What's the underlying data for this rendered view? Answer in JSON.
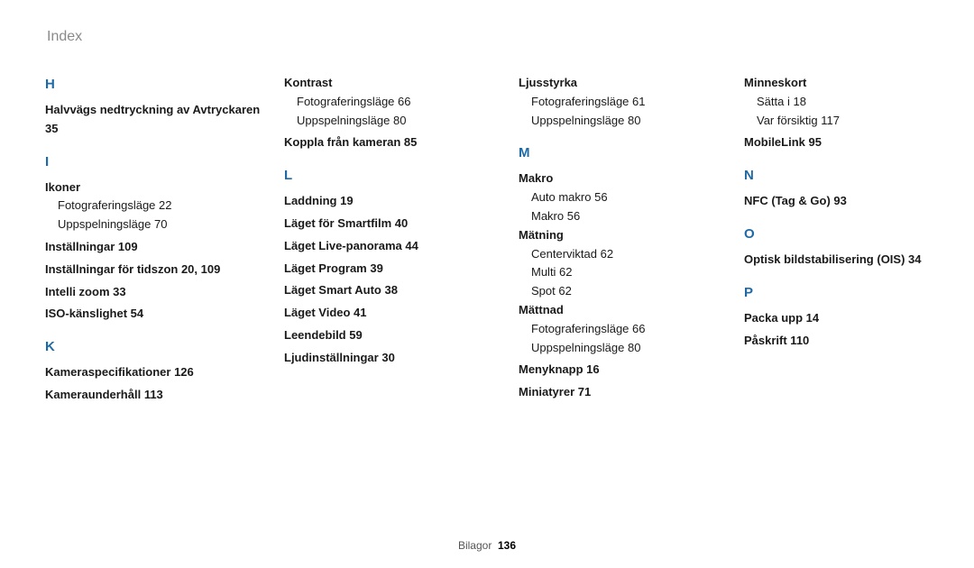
{
  "header": {
    "title": "Index"
  },
  "footer": {
    "section": "Bilagor",
    "page": "136"
  },
  "col1": {
    "H": {
      "entries": [
        {
          "type": "entry",
          "text": "Halvvägs nedtryckning av Avtryckaren  35"
        }
      ]
    },
    "I": {
      "entries": [
        {
          "type": "group",
          "head": "Ikoner",
          "subs": [
            "Fotograferingsläge  22",
            "Uppspelningsläge  70"
          ]
        },
        {
          "type": "entry",
          "text": "Inställningar  109"
        },
        {
          "type": "entry",
          "text": "Inställningar för tidszon  20, 109"
        },
        {
          "type": "entry",
          "text": "Intelli zoom  33"
        },
        {
          "type": "entry",
          "text": "ISO-känslighet  54"
        }
      ]
    },
    "K": {
      "entries": [
        {
          "type": "entry",
          "text": "Kameraspecifikationer  126"
        },
        {
          "type": "entry",
          "text": "Kameraunderhåll  113"
        }
      ]
    }
  },
  "col2": {
    "noletter": {
      "entries": [
        {
          "type": "group",
          "head": "Kontrast",
          "subs": [
            "Fotograferingsläge  66",
            "Uppspelningsläge  80"
          ]
        },
        {
          "type": "entry",
          "text": "Koppla från kameran  85"
        }
      ]
    },
    "L": {
      "entries": [
        {
          "type": "entry",
          "text": "Laddning  19"
        },
        {
          "type": "entry",
          "text": "Läget för Smartfilm  40"
        },
        {
          "type": "entry",
          "text": "Läget Live-panorama  44"
        },
        {
          "type": "entry",
          "text": "Läget Program  39"
        },
        {
          "type": "entry",
          "text": "Läget Smart Auto  38"
        },
        {
          "type": "entry",
          "text": "Läget Video  41"
        },
        {
          "type": "entry",
          "text": "Leendebild  59"
        },
        {
          "type": "entry",
          "text": "Ljudinställningar  30"
        }
      ]
    }
  },
  "col3": {
    "noletter": {
      "entries": [
        {
          "type": "group",
          "head": "Ljusstyrka",
          "subs": [
            "Fotograferingsläge  61",
            "Uppspelningsläge  80"
          ]
        }
      ]
    },
    "M": {
      "entries": [
        {
          "type": "group",
          "head": "Makro",
          "subs": [
            "Auto makro  56",
            "Makro  56"
          ]
        },
        {
          "type": "group",
          "head": "Mätning",
          "subs": [
            "Centerviktad  62",
            "Multi  62",
            "Spot  62"
          ]
        },
        {
          "type": "group",
          "head": "Mättnad",
          "subs": [
            "Fotograferingsläge  66",
            "Uppspelningsläge  80"
          ]
        },
        {
          "type": "entry",
          "text": "Menyknapp  16"
        },
        {
          "type": "entry",
          "text": "Miniatyrer  71"
        }
      ]
    }
  },
  "col4": {
    "noletter": {
      "entries": [
        {
          "type": "group",
          "head": "Minneskort",
          "subs": [
            "Sätta i  18",
            "Var försiktig  117"
          ]
        },
        {
          "type": "entry",
          "text": "MobileLink  95"
        }
      ]
    },
    "N": {
      "entries": [
        {
          "type": "entry",
          "text": "NFC (Tag & Go)  93"
        }
      ]
    },
    "O": {
      "entries": [
        {
          "type": "entry",
          "text": "Optisk bildstabilisering (OIS)  34"
        }
      ]
    },
    "P": {
      "entries": [
        {
          "type": "entry",
          "text": "Packa upp  14"
        },
        {
          "type": "entry",
          "text": "Påskrift  110"
        }
      ]
    }
  },
  "letters": {
    "H": "H",
    "I": "I",
    "K": "K",
    "L": "L",
    "M": "M",
    "N": "N",
    "O": "O",
    "P": "P"
  }
}
